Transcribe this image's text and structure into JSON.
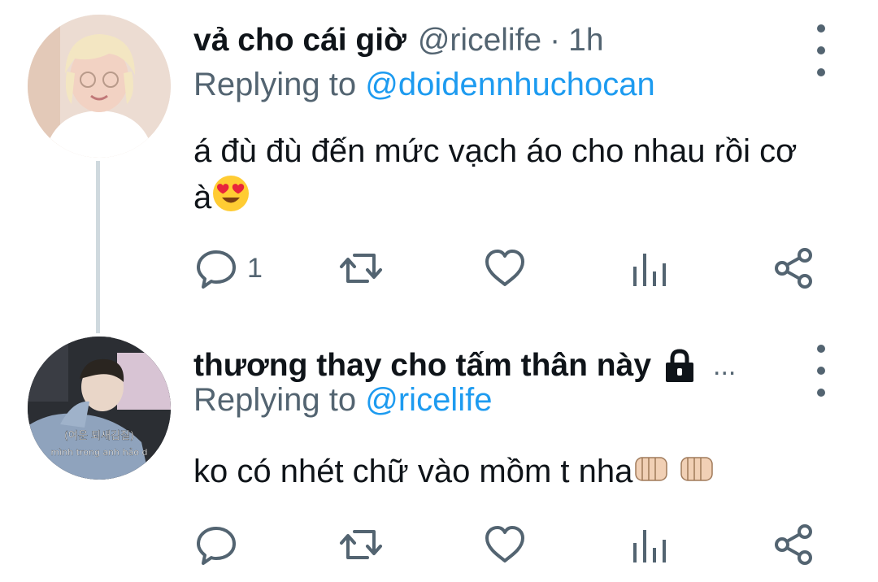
{
  "tweets": [
    {
      "display_name": "vả cho cái giờ",
      "handle": "@ricelife",
      "separator": "·",
      "time": "1h",
      "replying_prefix": "Replying to",
      "replying_handle": "@doidennhuchocan",
      "text": "á đù đù đến mức vạch áo cho nhau rồi cơ à",
      "emoji": "😍",
      "reply_count": "1",
      "avatar_colors": {
        "bg": "#ecdcd2",
        "hair": "#f3e6c2",
        "skin": "#f2d2c3",
        "shirt": "#ffffff"
      }
    },
    {
      "display_name": "thương thay cho tấm thân này",
      "truncation": "...",
      "replying_prefix": "Replying to",
      "replying_handle": "@ricelife",
      "text": "ko có nhét chữ vào mồm t nha",
      "emoji": "👊🏻 👊🏻",
      "reply_count": "",
      "avatar_caption_1": "(여운 퇴새김질)",
      "avatar_caption_2": "mình trong anh hảo d",
      "avatar_colors": {
        "bg": "#2b2e33",
        "jacket": "#8fa3bd",
        "window": "#d8c4d4"
      }
    }
  ],
  "icons": {
    "reply": "reply-icon",
    "retweet": "retweet-icon",
    "like": "heart-icon",
    "analytics": "analytics-icon",
    "share": "share-icon",
    "more": "more-vertical-icon",
    "protected": "lock-icon"
  },
  "colors": {
    "text": "#0f1419",
    "muted": "#536471",
    "link": "#1d9bf0",
    "thread_line": "#cfd9de"
  }
}
